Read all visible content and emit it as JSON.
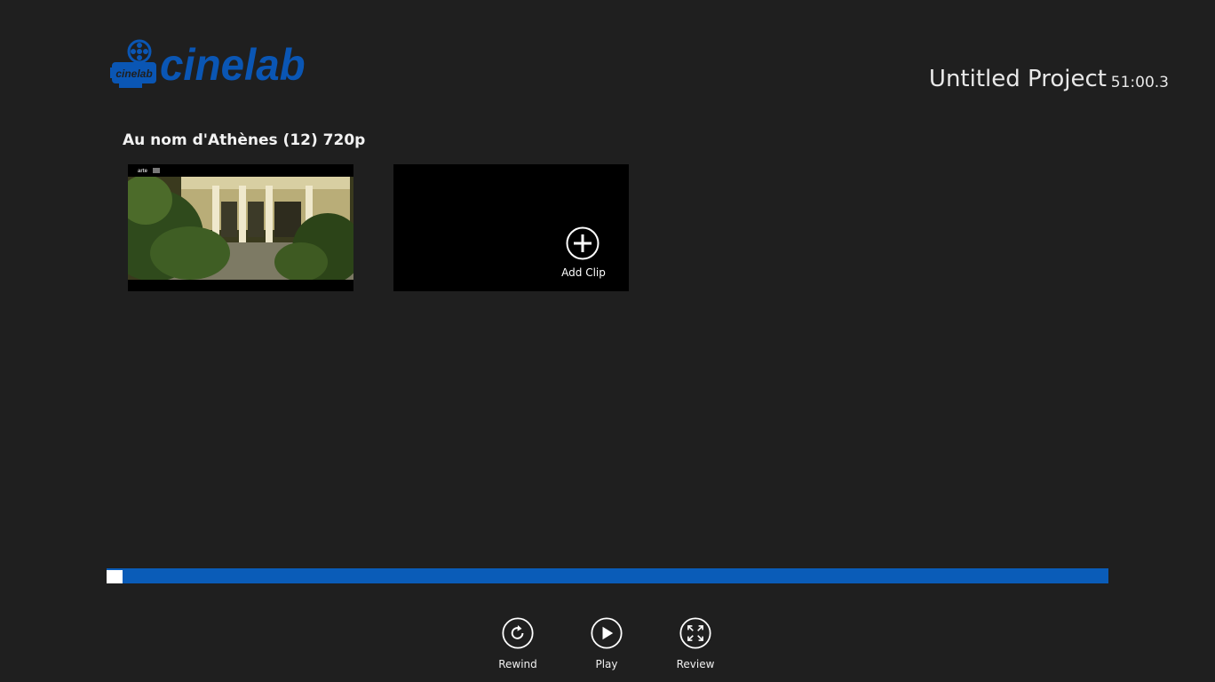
{
  "app": {
    "logo_badge_text": "cinelab",
    "logo_text": "cinelab",
    "brand_color": "#0a56b4"
  },
  "header": {
    "project_title": "Untitled Project",
    "duration": "51:00.3"
  },
  "clip_group": {
    "title": "Au nom d'Athènes (12) 720p",
    "clips": [
      {
        "thumbnail": "video-thumbnail",
        "watermark": "arte"
      }
    ],
    "add_clip_label": "Add Clip"
  },
  "timeline": {
    "bar_color": "#0a5cb8",
    "playhead_position": 0
  },
  "controls": {
    "rewind_label": "Rewind",
    "play_label": "Play",
    "review_label": "Review"
  },
  "icons": [
    "film-reel-icon",
    "add-icon",
    "rewind-icon",
    "play-icon",
    "fullscreen-icon"
  ]
}
